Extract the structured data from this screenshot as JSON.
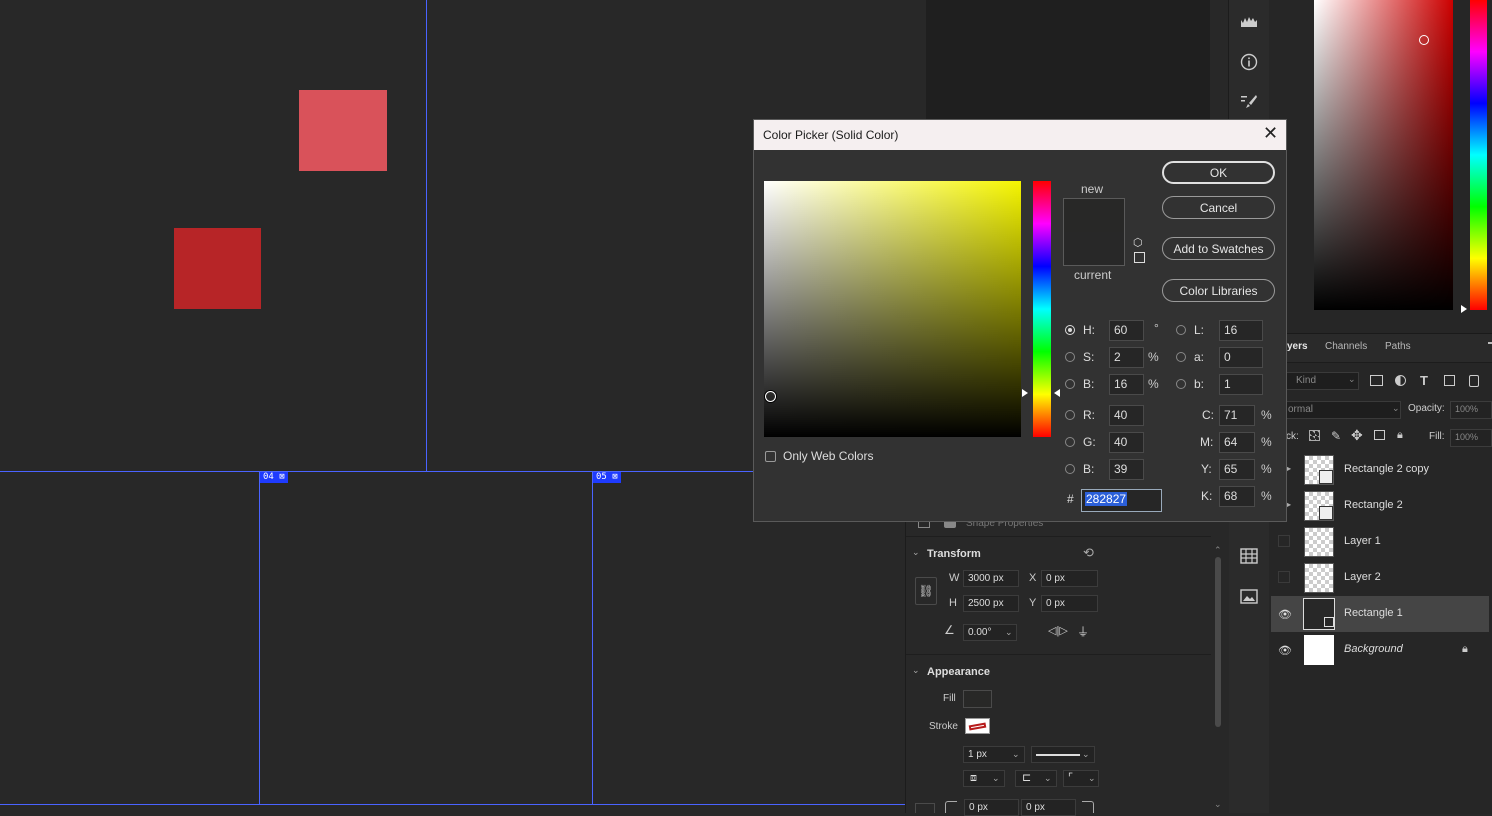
{
  "canvas": {
    "slices": [
      {
        "id": "slice-04",
        "label": "04"
      },
      {
        "id": "slice-05",
        "label": "05"
      }
    ],
    "shapes": [
      {
        "name": "pink-square",
        "color": "#d9525a"
      },
      {
        "name": "red-square",
        "color": "#b72527"
      }
    ]
  },
  "tool_strip_icons": [
    "histogram-icon",
    "info-icon",
    "brush-settings-icon",
    "table-icon",
    "image-panel-icon"
  ],
  "dialog": {
    "title": "Color Picker (Solid Color)",
    "ok_label": "OK",
    "cancel_label": "Cancel",
    "swatches_label": "Add to Swatches",
    "libraries_label": "Color Libraries",
    "new_label": "new",
    "current_label": "current",
    "only_web_label": "Only Web Colors",
    "hex_symbol": "#",
    "hex_value": "282827",
    "new_color": "#282827",
    "current_color": "#282828",
    "hue_base": "#f5f500",
    "fields": {
      "h": {
        "label": "H:",
        "value": "60",
        "unit": "°"
      },
      "s": {
        "label": "S:",
        "value": "2",
        "unit": "%"
      },
      "bri": {
        "label": "B:",
        "value": "16",
        "unit": "%"
      },
      "r": {
        "label": "R:",
        "value": "40"
      },
      "g": {
        "label": "G:",
        "value": "40"
      },
      "b": {
        "label": "B:",
        "value": "39"
      },
      "l": {
        "label": "L:",
        "value": "16"
      },
      "a": {
        "label": "a:",
        "value": "0"
      },
      "lab_b": {
        "label": "b:",
        "value": "1"
      },
      "c": {
        "label": "C:",
        "value": "71",
        "unit": "%"
      },
      "m": {
        "label": "M:",
        "value": "64",
        "unit": "%"
      },
      "y": {
        "label": "Y:",
        "value": "65",
        "unit": "%"
      },
      "k": {
        "label": "K:",
        "value": "68",
        "unit": "%"
      }
    }
  },
  "properties": {
    "header": "Shape Properties",
    "transform_title": "Transform",
    "w_label": "W",
    "w_value": "3000 px",
    "x_label": "X",
    "x_value": "0 px",
    "h_label": "H",
    "h_value": "2500 px",
    "y_label": "Y",
    "y_value": "0 px",
    "angle_value": "0.00°",
    "appearance_title": "Appearance",
    "fill_label": "Fill",
    "stroke_label": "Stroke",
    "stroke_width": "1 px",
    "corner_1": "0 px",
    "corner_2": "0 px"
  },
  "layers_panel": {
    "tabs": [
      "yers",
      "Channels",
      "Paths"
    ],
    "filter_placeholder": "Kind",
    "blend_mode": "ormal",
    "opacity_label": "Opacity:",
    "opacity_value": "100%",
    "lock_label": "ck:",
    "fill_label": "Fill:",
    "fill_value": "100%",
    "layers": [
      {
        "name": "Rectangle 2 copy",
        "visible": false
      },
      {
        "name": "Rectangle 2",
        "visible": false
      },
      {
        "name": "Layer 1",
        "visible": false
      },
      {
        "name": "Layer 2",
        "visible": false
      },
      {
        "name": "Rectangle 1",
        "visible": true,
        "selected": true
      },
      {
        "name": "Background",
        "visible": true,
        "locked": true
      }
    ]
  }
}
